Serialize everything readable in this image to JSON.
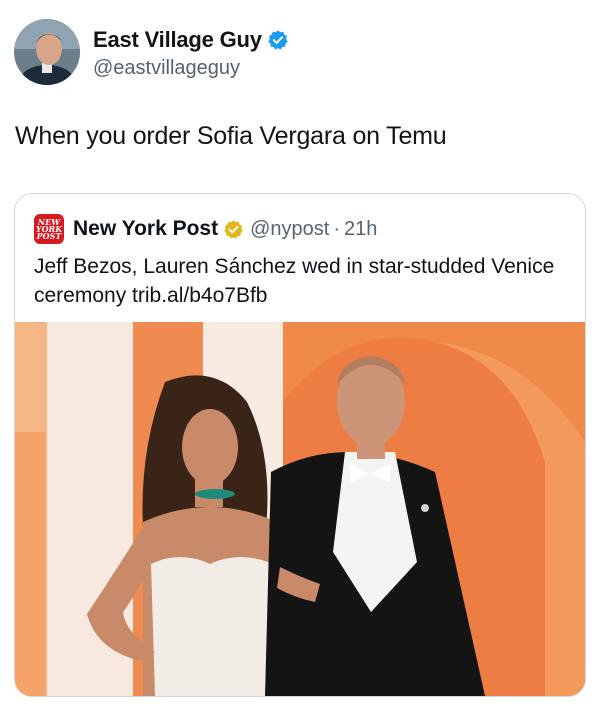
{
  "tweet": {
    "display_name": "East Village Guy",
    "handle": "@eastvillageguy",
    "text": "When you order Sofia Vergara on Temu",
    "avatar_icon": "profile-photo",
    "verified_color": "#1d9bf0"
  },
  "quoted_tweet": {
    "display_name": "New York Post",
    "logo_text": "NEW YORK POST",
    "handle": "@nypost",
    "separator": "·",
    "time": "21h",
    "text": "Jeff Bezos, Lauren Sánchez wed in star-studded Venice ceremony trib.al/b4o7Bfb",
    "verified_color": "#e2b719",
    "brand_color": "#d71920",
    "photo_icon": "news-photo"
  }
}
